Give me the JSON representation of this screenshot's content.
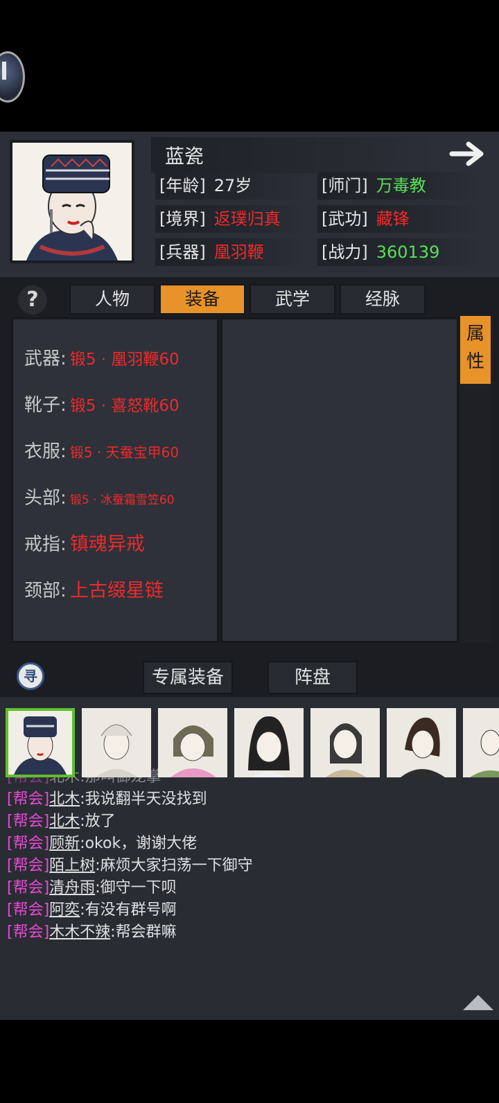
{
  "character": {
    "name": "蓝瓷",
    "fields": [
      {
        "label": "[年龄]",
        "value": "27岁",
        "color": "#e6e6e6"
      },
      {
        "label": "[师门]",
        "value": "万毒教",
        "color": "#57e057"
      },
      {
        "label": "[境界]",
        "value": "返璞归真",
        "color": "#ee2a2a"
      },
      {
        "label": "[武功]",
        "value": "藏锋",
        "color": "#ee2a2a"
      },
      {
        "label": "[兵器]",
        "value": "凰羽鞭",
        "color": "#ee2a2a"
      },
      {
        "label": "[战力]",
        "value": "360139",
        "color": "#57e057"
      }
    ]
  },
  "tabs": [
    {
      "label": "人物",
      "active": false
    },
    {
      "label": "装备",
      "active": true
    },
    {
      "label": "武学",
      "active": false
    },
    {
      "label": "经脉",
      "active": false
    }
  ],
  "help_label": "?",
  "side_tab_label": [
    "属",
    "性"
  ],
  "equipment": [
    {
      "slot": "武器:",
      "item": "锻5 · 凰羽鞭60"
    },
    {
      "slot": "靴子:",
      "item": "锻5 · 喜怒靴60"
    },
    {
      "slot": "衣服:",
      "item": "锻5 · 天蚕宝甲60"
    },
    {
      "slot": "头部:",
      "item": "锻5 · 冰蚕霜雪笠60"
    },
    {
      "slot": "戒指:",
      "item": "镇魂异戒"
    },
    {
      "slot": "颈部:",
      "item": "上古缀星链"
    }
  ],
  "bottom_buttons": {
    "exclusive": "专属装备",
    "formation": "阵盘",
    "search_glyph": "寻"
  },
  "chat": {
    "partial_top": "北木:那叫御龙掌",
    "messages": [
      {
        "tag": "[帮会]",
        "user": "北木",
        "text": ":我说翻半天没找到"
      },
      {
        "tag": "[帮会]",
        "user": "北木",
        "text": ":放了"
      },
      {
        "tag": "[帮会]",
        "user": "顾新",
        "text": ":okok，谢谢大佬"
      },
      {
        "tag": "[帮会]",
        "user": "陌上树",
        "text": ":麻烦大家扫荡一下御守"
      },
      {
        "tag": "[帮会]",
        "user": "清舟雨",
        "text": ":御守一下呗"
      },
      {
        "tag": "[帮会]",
        "user": "阿奕",
        "text": ":有没有群号啊"
      },
      {
        "tag": "[帮会]",
        "user": "木木不辣",
        "text": ":帮会群嘛"
      }
    ]
  }
}
